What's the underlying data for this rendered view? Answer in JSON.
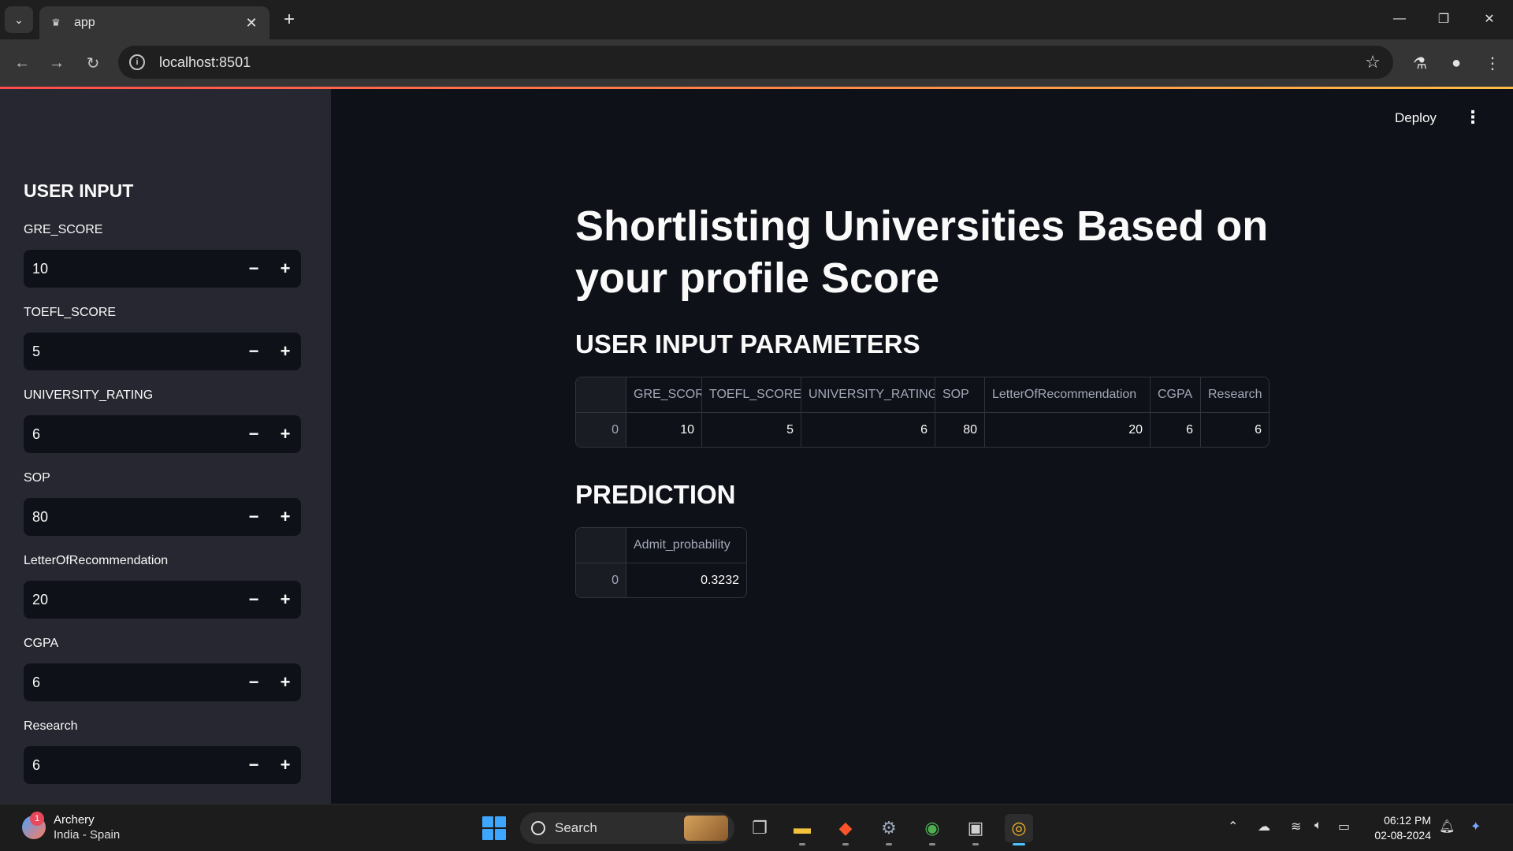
{
  "browser": {
    "tab_title": "app",
    "url": "localhost:8501"
  },
  "sidebar": {
    "title": "USER INPUT",
    "fields": [
      {
        "label": "GRE_SCORE",
        "value": "10"
      },
      {
        "label": "TOEFL_SCORE",
        "value": "5"
      },
      {
        "label": "UNIVERSITY_RATING",
        "value": "6"
      },
      {
        "label": "SOP",
        "value": "80"
      },
      {
        "label": "LetterOfRecommendation",
        "value": "20"
      },
      {
        "label": "CGPA",
        "value": "6"
      },
      {
        "label": "Research",
        "value": "6"
      }
    ],
    "minus": "−",
    "plus": "+"
  },
  "main": {
    "deploy_label": "Deploy",
    "title": "Shortlisting Universities Based on your profile Score",
    "params_heading": "USER INPUT PARAMETERS",
    "params_table": {
      "columns": [
        "GRE_SCORE",
        "TOEFL_SCORE",
        "UNIVERSITY_RATING",
        "SOP",
        "LetterOfRecommendation",
        "CGPA",
        "Research"
      ],
      "rows": [
        {
          "index": "0",
          "values": [
            "10",
            "5",
            "6",
            "80",
            "20",
            "6",
            "6"
          ]
        }
      ]
    },
    "prediction_heading": "PREDICTION",
    "prediction_table": {
      "columns": [
        "Admit_probability"
      ],
      "rows": [
        {
          "index": "0",
          "values": [
            "0.3232"
          ]
        }
      ]
    }
  },
  "taskbar": {
    "weather_badge": "1",
    "weather_title": "Archery",
    "weather_sub": "India - Spain",
    "search_label": "Search",
    "time": "06:12 PM",
    "date": "02-08-2024"
  }
}
